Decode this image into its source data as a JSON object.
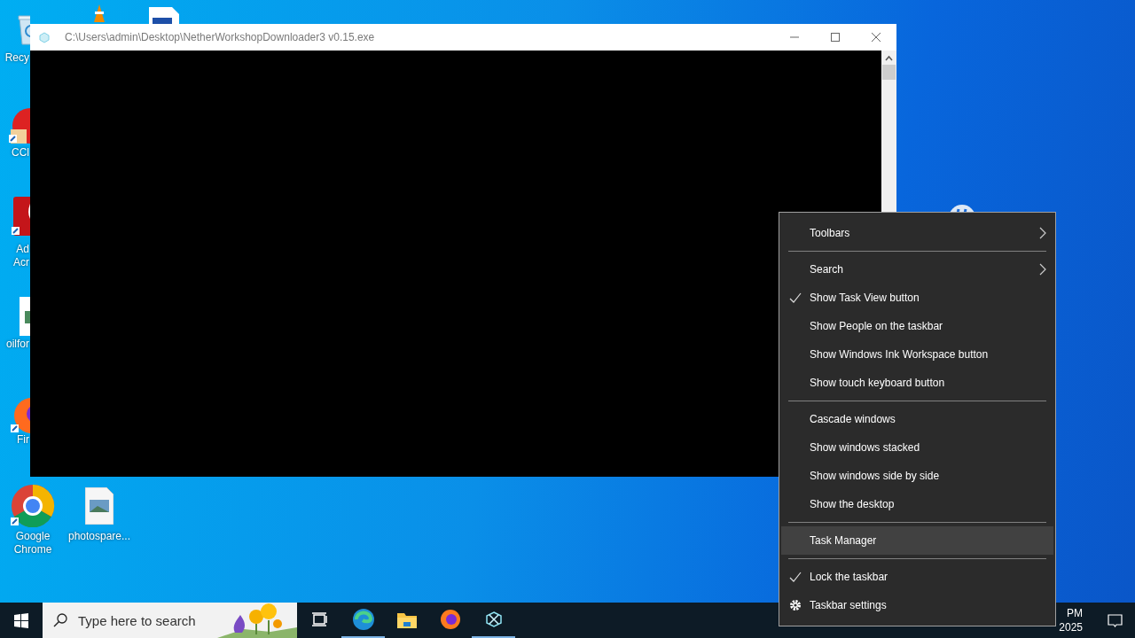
{
  "desktop_icons": [
    {
      "label": "Recy"
    },
    {
      "label": "CCl"
    },
    {
      "label": "Ad Acr"
    },
    {
      "label": "oilfor"
    },
    {
      "label": "Fir"
    },
    {
      "label": "Google Chrome"
    },
    {
      "label": "photospare..."
    }
  ],
  "window": {
    "title": "C:\\Users\\admin\\Desktop\\NetherWorkshopDownloader3 v0.15.exe"
  },
  "context_menu": {
    "groups": [
      [
        {
          "kind": "submenu",
          "label": "Toolbars",
          "selected": false
        }
      ],
      [
        {
          "kind": "submenu",
          "label": "Search",
          "selected": false
        },
        {
          "kind": "toggle",
          "label": "Show Task View button",
          "checked": true,
          "selected": false
        },
        {
          "kind": "toggle",
          "label": "Show People on the taskbar",
          "checked": false,
          "selected": false
        },
        {
          "kind": "toggle",
          "label": "Show Windows Ink Workspace button",
          "checked": false,
          "selected": false
        },
        {
          "kind": "toggle",
          "label": "Show touch keyboard button",
          "checked": false,
          "selected": false
        }
      ],
      [
        {
          "kind": "command",
          "label": "Cascade windows",
          "selected": false
        },
        {
          "kind": "command",
          "label": "Show windows stacked",
          "selected": false
        },
        {
          "kind": "command",
          "label": "Show windows side by side",
          "selected": false
        },
        {
          "kind": "command",
          "label": "Show the desktop",
          "selected": false
        }
      ],
      [
        {
          "kind": "command",
          "label": "Task Manager",
          "selected": true
        }
      ],
      [
        {
          "kind": "toggle",
          "label": "Lock the taskbar",
          "checked": true,
          "selected": false
        },
        {
          "kind": "settings",
          "label": "Taskbar settings",
          "selected": false
        }
      ]
    ]
  },
  "taskbar": {
    "search": {
      "placeholder": "Type here to search"
    },
    "apps": [
      {
        "running": false
      },
      {
        "running": true
      },
      {
        "running": false
      },
      {
        "running": false
      },
      {
        "running": true
      }
    ],
    "clock": {
      "time": "PM",
      "date": "2025"
    }
  }
}
